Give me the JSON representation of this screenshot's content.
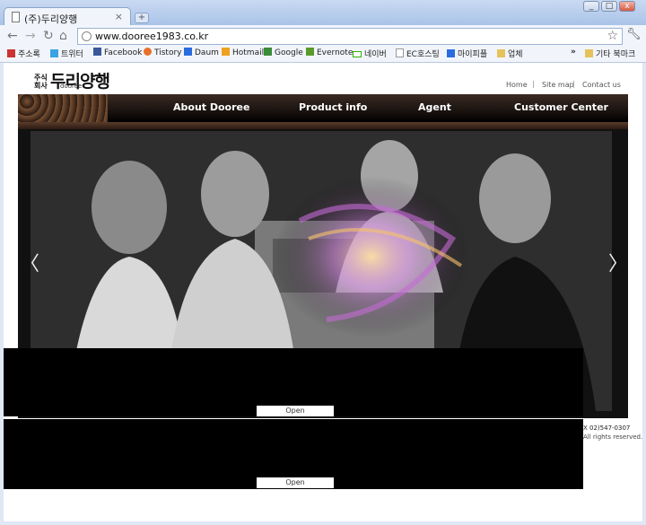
{
  "browser": {
    "tab_title": "(주)두리양행",
    "tab_close": "×",
    "new_tab": "+",
    "url": "www.dooree1983.co.kr",
    "bookmarks": [
      {
        "label": "주소록",
        "icon": "gmail-icon",
        "color": "#c33"
      },
      {
        "label": "트위터",
        "icon": "twitter-icon",
        "color": "#3aa3e3"
      },
      {
        "label": "Facebook",
        "icon": "facebook-icon",
        "color": "#3b5998"
      },
      {
        "label": "Tistory",
        "icon": "tistory-icon",
        "color": "#e8702a"
      },
      {
        "label": "Daum",
        "icon": "daum-icon",
        "color": "#2a6ce0"
      },
      {
        "label": "Hotmail",
        "icon": "hotmail-icon",
        "color": "#f0a020"
      },
      {
        "label": "Google",
        "icon": "google-icon",
        "color": "#3a8c3a"
      },
      {
        "label": "Evernote",
        "icon": "evernote-icon",
        "color": "#5a9a2a"
      },
      {
        "label": "네이버",
        "icon": "naver-icon",
        "color": "#2db400"
      },
      {
        "label": "EC호스팅",
        "icon": "page-icon",
        "color": "#999"
      },
      {
        "label": "마이피플",
        "icon": "mypeople-icon",
        "color": "#2a6ce0"
      },
      {
        "label": "업체",
        "icon": "folder-icon",
        "color": "#e6c25a"
      }
    ],
    "overflow": "»",
    "other_bookmarks": "기타 북마크"
  },
  "site": {
    "logo_small": "주식회사",
    "logo_main": "두리양행",
    "logo_en": "dooree",
    "top_links": [
      "Home",
      "Site map",
      "Contact us"
    ],
    "separator": "|",
    "nav": [
      "About Dooree",
      "Product info",
      "Agent",
      "Customer Center"
    ],
    "prev_arrow": "〈",
    "next_arrow": "〉",
    "open_label": "Open",
    "footer_fax": "X  02)547-0307",
    "footer_rights": "All rights reserved."
  }
}
